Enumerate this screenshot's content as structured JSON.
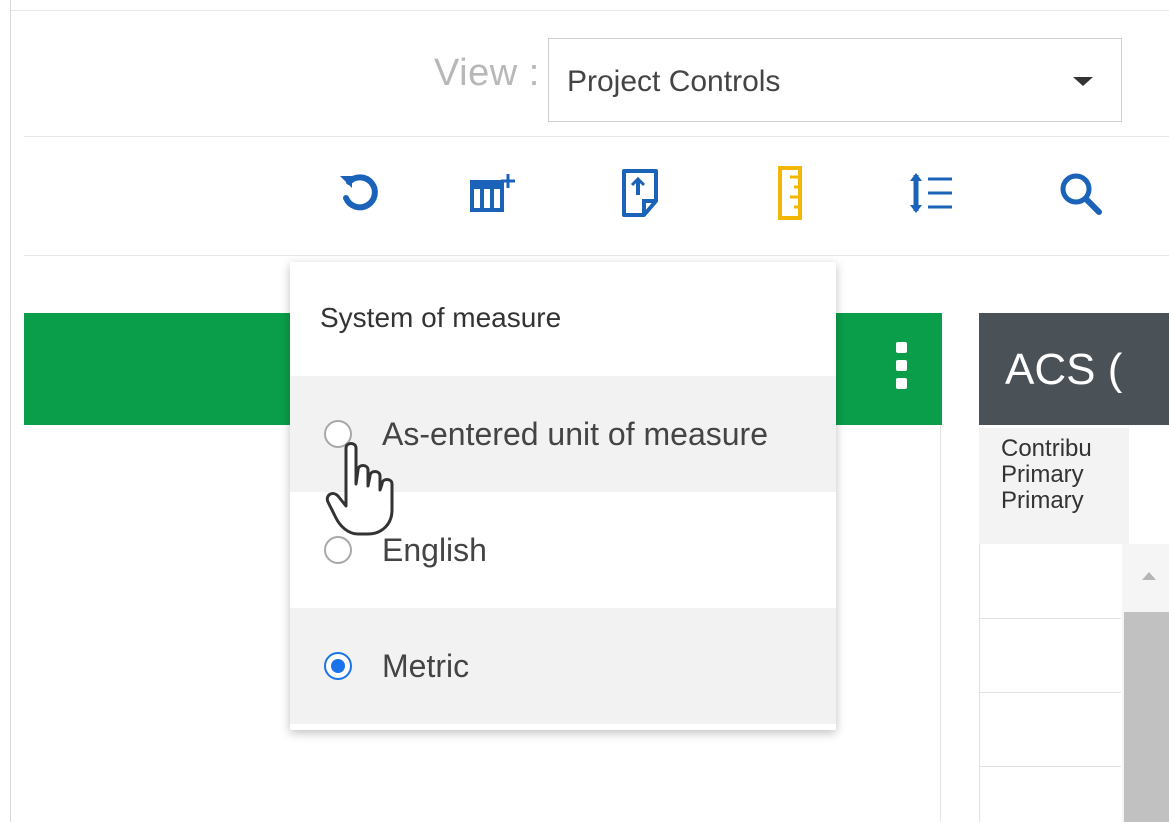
{
  "view": {
    "label": "View :",
    "selected": "Project Controls"
  },
  "toolbar": {
    "icons": [
      "refresh-icon",
      "columns-icon",
      "document-icon",
      "ruler-icon",
      "line-height-icon",
      "search-icon"
    ]
  },
  "acs": {
    "header": "ACS (",
    "sub_lines": [
      "Contribu",
      "Primary",
      "Primary"
    ]
  },
  "measure_menu": {
    "title": "System of measure",
    "options": [
      {
        "label": "As-entered unit of measure",
        "checked": false
      },
      {
        "label": "English",
        "checked": false
      },
      {
        "label": "Metric",
        "checked": true
      }
    ]
  },
  "colors": {
    "green_bar": "#0a9e4a",
    "acs_header": "#4a5157",
    "toolbar_icon": "#1a63b8",
    "ruler_icon": "#f2b705",
    "radio_checked": "#1a73e8"
  }
}
